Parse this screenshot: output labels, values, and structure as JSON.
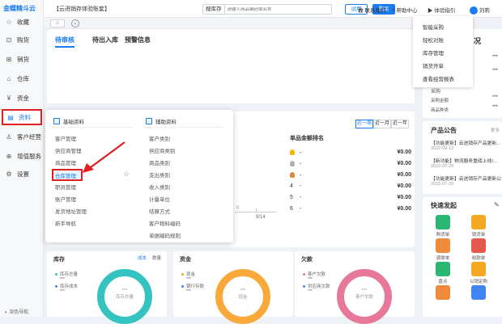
{
  "app": {
    "logo": "金蝶精斗云",
    "account": "【云进销存体验账套】"
  },
  "sidebar": {
    "items": [
      {
        "label": "收藏",
        "icon": "star-icon"
      },
      {
        "label": "购货",
        "icon": "cart-icon"
      },
      {
        "label": "销货",
        "icon": "sales-icon"
      },
      {
        "label": "仓库",
        "icon": "warehouse-icon"
      },
      {
        "label": "资金",
        "icon": "money-icon"
      },
      {
        "label": "资料",
        "icon": "document-icon"
      },
      {
        "label": "客户经营",
        "icon": "customer-icon"
      },
      {
        "label": "增值服务",
        "icon": "value-added-icon"
      },
      {
        "label": "设置",
        "icon": "settings-icon"
      }
    ],
    "bottom": "深色导航"
  },
  "topbar": {
    "search_type": "搜库存",
    "search_placeholder": "请输入商品编码或名称",
    "try_label": "试用",
    "buy_label": "购买",
    "contact": "联系我们",
    "help": "帮助中心",
    "guide": "体验指引",
    "user": "刘莉"
  },
  "colors": {
    "accent": "#1a7cf0",
    "highlight": "#e02020"
  },
  "tabs": {
    "subtabs": [
      "待审核",
      "待出入库",
      "预警信息"
    ]
  },
  "guide_menu": [
    "智能采购",
    "轻松对账",
    "库存管理",
    "销货开单",
    "查看经营报表"
  ],
  "popup": {
    "col1_title": "基础资料",
    "col1": [
      "客户管理",
      "供应商管理",
      "商品管理",
      "仓库管理",
      "职员管理",
      "账户管理",
      "发货地址管理",
      "新手导航"
    ],
    "col2_title": "辅助资料",
    "col2": [
      "客户类别",
      "供应商类别",
      "商品类别",
      "支出类别",
      "收入类别",
      "计量单位",
      "结算方式",
      "客户物料编码",
      "单据编码规则"
    ]
  },
  "ranking": {
    "title": "单品金额排名",
    "range": [
      "近一周",
      "近一月",
      "近一年"
    ],
    "rows": [
      {
        "num": "",
        "name": "-",
        "value": "¥0.00"
      },
      {
        "num": "",
        "name": "-",
        "value": "¥0.00"
      },
      {
        "num": "",
        "name": "-",
        "value": "¥0.00"
      },
      {
        "num": "4",
        "name": "-",
        "value": "¥0.00"
      },
      {
        "num": "5",
        "name": "-",
        "value": "¥0.00"
      },
      {
        "num": "6",
        "name": "-",
        "value": "¥0.00"
      }
    ],
    "axis": {
      "y0": "0",
      "x": "9/14"
    }
  },
  "right": {
    "partial_title": "况",
    "mask": "***",
    "purchase": "采购",
    "purchase_amount": "采购金额",
    "goods_kinds": "商品种类",
    "announce_title": "产品公告",
    "more": "更多",
    "news": [
      {
        "title": "【功能更新】云进销存产品更新...",
        "date": "2022-09-13"
      },
      {
        "title": "【新功能】物流服务重磅上线!...",
        "date": "2022-07-29"
      },
      {
        "title": "【功能更新】云进销存产品更新公告",
        "date": "2022-07-29"
      }
    ],
    "quick_title": "快速发起",
    "quick": [
      {
        "label": "购货单",
        "icon": "purchase-order-icon",
        "color": "#2bb673"
      },
      {
        "label": "销货单",
        "icon": "sales-order-icon",
        "color": "#f7a823"
      },
      {
        "label": "调拨单",
        "icon": "transfer-order-icon",
        "color": "#f28a3c"
      },
      {
        "label": "收款单",
        "icon": "receipt-icon",
        "color": "#e8574d"
      },
      {
        "label": "盘点",
        "icon": "inventory-count-icon",
        "color": "#2bb673"
      },
      {
        "label": "以销定购",
        "icon": "sales-to-purchase-icon",
        "color": "#f7a823"
      },
      {
        "label": "",
        "icon": "more-quick-icon",
        "color": "#f28a3c"
      },
      {
        "label": "",
        "icon": "more-quick-icon-2",
        "color": "#3f86f4"
      }
    ]
  },
  "panels": [
    {
      "title": "库存",
      "tabs": [
        "成本",
        "数量"
      ],
      "legend": [
        "库存总量",
        "库存成本"
      ],
      "center": "库存总量",
      "mask": "***",
      "color": "#34c3c0"
    },
    {
      "title": "资金",
      "legend": [
        "现金",
        "银行存款"
      ],
      "center": "现金",
      "mask": "***",
      "color": "#f8a93a"
    },
    {
      "title": "欠款",
      "legend": [
        "客户欠款",
        "供应商欠款"
      ],
      "center": "客户欠款",
      "mask": "***",
      "color": "#e8789a"
    }
  ]
}
